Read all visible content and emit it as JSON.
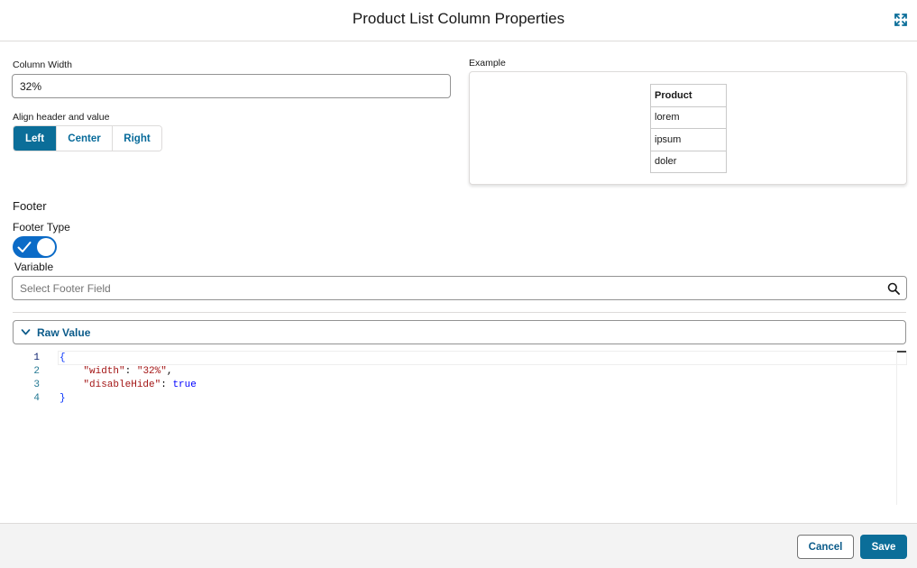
{
  "modal": {
    "title": "Product List Column Properties"
  },
  "column_width": {
    "label": "Column Width",
    "value": "32%"
  },
  "align": {
    "label": "Align header and value",
    "options": [
      "Left",
      "Center",
      "Right"
    ],
    "selected": "Left"
  },
  "example": {
    "label": "Example",
    "header": "Product",
    "rows": [
      "lorem",
      "ipsum",
      "doler"
    ]
  },
  "footer_section": {
    "title": "Footer",
    "type_label": "Footer Type",
    "toggle_on": true,
    "variable_label": "Variable",
    "field_placeholder": "Select Footer Field"
  },
  "raw_value": {
    "label": "Raw Value",
    "expanded": true,
    "lines": [
      {
        "num": "1",
        "code": "{"
      },
      {
        "num": "2",
        "code": "    \"width\": \"32%\","
      },
      {
        "num": "3",
        "code": "    \"disableHide\": true"
      },
      {
        "num": "4",
        "code": "}"
      }
    ]
  },
  "actions": {
    "cancel_label": "Cancel",
    "save_label": "Save"
  },
  "colors": {
    "brand": "#0b6e99",
    "toggle": "#0b6bc7"
  },
  "icons": {
    "expand": "expand-icon",
    "search": "search-icon",
    "chevron": "chevron-down-icon",
    "check": "check-icon"
  }
}
